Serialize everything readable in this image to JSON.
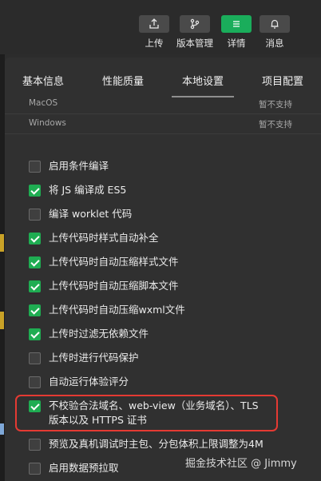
{
  "toolbar": {
    "items": [
      {
        "label": "上传",
        "icon": "upload-icon"
      },
      {
        "label": "版本管理",
        "icon": "branch-icon"
      },
      {
        "label": "详情",
        "icon": "menu-icon",
        "active": true
      },
      {
        "label": "消息",
        "icon": "bell-icon"
      }
    ]
  },
  "tabs": [
    {
      "label": "基本信息"
    },
    {
      "label": "性能质量"
    },
    {
      "label": "本地设置",
      "selected": true
    },
    {
      "label": "项目配置"
    }
  ],
  "os_rows": [
    {
      "name": "MacOS",
      "status": "暂不支持"
    },
    {
      "name": "Windows",
      "status": "暂不支持"
    }
  ],
  "options": [
    {
      "label": "启用条件编译",
      "checked": false
    },
    {
      "label": "将 JS 编译成 ES5",
      "checked": true
    },
    {
      "label": "编译 worklet 代码",
      "checked": false
    },
    {
      "label": "上传代码时样式自动补全",
      "checked": true
    },
    {
      "label": "上传代码时自动压缩样式文件",
      "checked": true
    },
    {
      "label": "上传代码时自动压缩脚本文件",
      "checked": true
    },
    {
      "label": "上传代码时自动压缩wxml文件",
      "checked": true
    },
    {
      "label": "上传时过滤无依赖文件",
      "checked": true
    },
    {
      "label": "上传时进行代码保护",
      "checked": false
    },
    {
      "label": "自动运行体验评分",
      "checked": false
    },
    {
      "label": "不校验合法域名、web-view（业务域名）、TLS",
      "label2": "版本以及 HTTPS 证书",
      "checked": true
    },
    {
      "label": "预览及真机调试时主包、分包体积上限调整为4M",
      "checked": false
    },
    {
      "label": "启用数据预拉取",
      "checked": false
    }
  ],
  "watermark": "掘金技术社区 @ Jimmy",
  "colors": {
    "accent": "#1fad52",
    "highlight": "#e53a33",
    "background": "#303030"
  }
}
